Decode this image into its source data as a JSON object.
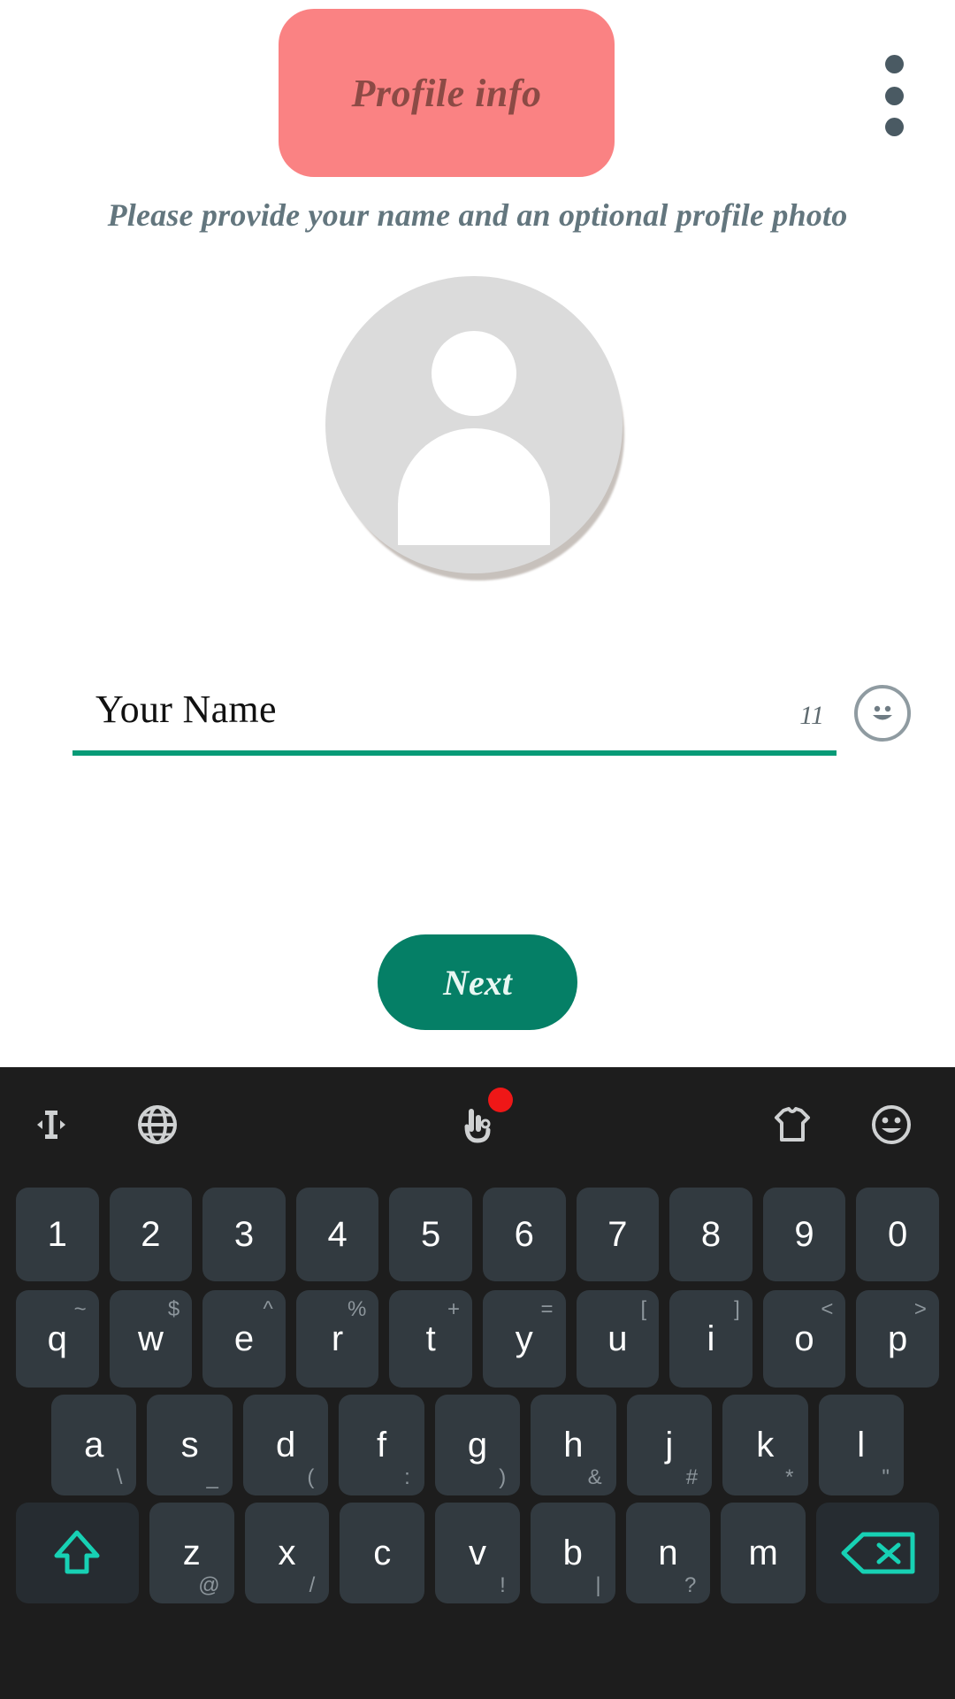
{
  "app": {
    "title": "Profile info",
    "subtitle": "Please provide your name and an optional profile photo",
    "menu_icon": "kebab-menu-icon",
    "avatar_icon": "default-person-avatar-icon",
    "name_field": {
      "value": "Your Name",
      "placeholder": "Your Name",
      "char_count": "11",
      "emoji_icon": "smiley-face-icon"
    },
    "next_label": "Next",
    "colors": {
      "title_pill": "#fa8283",
      "title_text": "#8c4a45",
      "subtitle": "#63767e",
      "accent_green": "#079b77",
      "next_button": "#057f66",
      "avatar_bg": "#dbdbdb",
      "kebab": "#4a5a63"
    }
  },
  "keyboard": {
    "bg": "#1d1d1d",
    "key_bg": "#323a40",
    "mod_key_bg": "#262c31",
    "accent": "#17d1b4",
    "toolbar": [
      {
        "name": "cursor-move-icon",
        "badge": false
      },
      {
        "name": "globe-language-icon",
        "badge": false
      },
      {
        "name": "gesture-hand-icon",
        "badge": true
      },
      {
        "name": "tshirt-theme-icon",
        "badge": false
      },
      {
        "name": "emoji-face-icon",
        "badge": false
      }
    ],
    "rows": {
      "numbers": [
        {
          "main": "1"
        },
        {
          "main": "2"
        },
        {
          "main": "3"
        },
        {
          "main": "4"
        },
        {
          "main": "5"
        },
        {
          "main": "6"
        },
        {
          "main": "7"
        },
        {
          "main": "8"
        },
        {
          "main": "9"
        },
        {
          "main": "0"
        }
      ],
      "top": [
        {
          "main": "q",
          "sub": "~"
        },
        {
          "main": "w",
          "sub": "$"
        },
        {
          "main": "e",
          "sub": "^"
        },
        {
          "main": "r",
          "sub": "%"
        },
        {
          "main": "t",
          "sub": "+"
        },
        {
          "main": "y",
          "sub": "="
        },
        {
          "main": "u",
          "sub": "["
        },
        {
          "main": "i",
          "sub": "]"
        },
        {
          "main": "o",
          "sub": "<"
        },
        {
          "main": "p",
          "sub": ">"
        }
      ],
      "home": [
        {
          "main": "a",
          "sub": "\\"
        },
        {
          "main": "s",
          "sub": "_"
        },
        {
          "main": "d",
          "sub": "("
        },
        {
          "main": "f",
          "sub": ":"
        },
        {
          "main": "g",
          "sub": ")"
        },
        {
          "main": "h",
          "sub": "&"
        },
        {
          "main": "j",
          "sub": "#"
        },
        {
          "main": "k",
          "sub": "*"
        },
        {
          "main": "l",
          "sub": "\""
        }
      ],
      "bottom": [
        {
          "main": "shift",
          "icon": "shift-arrow-icon"
        },
        {
          "main": "z",
          "sub": "@"
        },
        {
          "main": "x",
          "sub": "/"
        },
        {
          "main": "c",
          "sub": ""
        },
        {
          "main": "v",
          "sub": "!"
        },
        {
          "main": "b",
          "sub": "|"
        },
        {
          "main": "n",
          "sub": "?"
        },
        {
          "main": "m",
          "sub": ""
        },
        {
          "main": "backspace",
          "icon": "backspace-icon"
        }
      ]
    }
  }
}
